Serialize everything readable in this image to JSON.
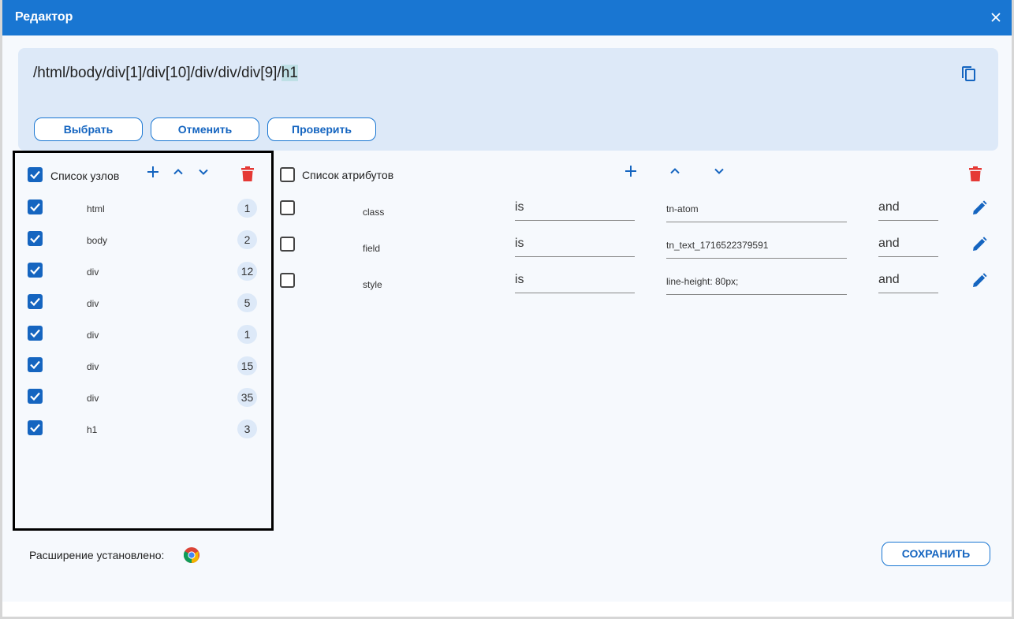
{
  "dialog": {
    "title": "Редактор"
  },
  "xpath": {
    "prefix": "/html/body/div[1]/div[10]/div/div/div[9]/",
    "highlight": "h1"
  },
  "actions": {
    "select": "Выбрать",
    "cancel": "Отменить",
    "check": "Проверить"
  },
  "nodes": {
    "header": "Список узлов",
    "all_checked": true,
    "items": [
      {
        "name": "html",
        "count": "1",
        "checked": true
      },
      {
        "name": "body",
        "count": "2",
        "checked": true
      },
      {
        "name": "div",
        "count": "12",
        "checked": true
      },
      {
        "name": "div",
        "count": "5",
        "checked": true
      },
      {
        "name": "div",
        "count": "1",
        "checked": true
      },
      {
        "name": "div",
        "count": "15",
        "checked": true
      },
      {
        "name": "div",
        "count": "35",
        "checked": true
      },
      {
        "name": "h1",
        "count": "3",
        "checked": true
      }
    ]
  },
  "attributes": {
    "header": "Список атрибутов",
    "all_checked": false,
    "items": [
      {
        "name": "class",
        "operator": "is",
        "value": "tn-atom",
        "join": "and",
        "checked": false
      },
      {
        "name": "field",
        "operator": "is",
        "value": "tn_text_1716522379591",
        "join": "and",
        "checked": false
      },
      {
        "name": "style",
        "operator": "is",
        "value": "line-height: 80px;",
        "join": "and",
        "checked": false
      }
    ]
  },
  "footer": {
    "extension_label": "Расширение установлено:",
    "save": "СОХРАНИТЬ"
  },
  "colors": {
    "primary": "#1976d2",
    "danger": "#e53935",
    "panel": "#dde9f8"
  },
  "icons": [
    "close-icon",
    "copy-icon",
    "plus-icon",
    "chevron-up-icon",
    "chevron-down-icon",
    "trash-icon",
    "pencil-icon",
    "chrome-icon",
    "check-icon"
  ]
}
